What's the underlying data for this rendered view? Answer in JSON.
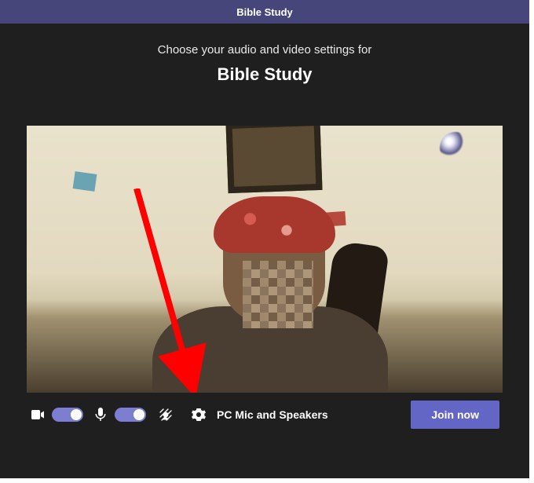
{
  "titleBar": {
    "title": "Bible Study"
  },
  "header": {
    "subtitle": "Choose your audio and video settings for",
    "meetingName": "Bible Study"
  },
  "controls": {
    "camera": {
      "iconName": "video-camera-icon",
      "on": true
    },
    "mic": {
      "iconName": "microphone-icon",
      "on": true
    },
    "backgroundEffects": {
      "iconName": "background-effects-icon"
    },
    "deviceSettings": {
      "iconName": "gear-icon"
    },
    "deviceLabel": "PC Mic and Speakers",
    "joinLabel": "Join now"
  },
  "annotation": {
    "arrowColor": "#ff0000"
  },
  "colors": {
    "accent": "#6366c4",
    "toggle": "#7b7ed1",
    "titleBar": "#46467a"
  }
}
